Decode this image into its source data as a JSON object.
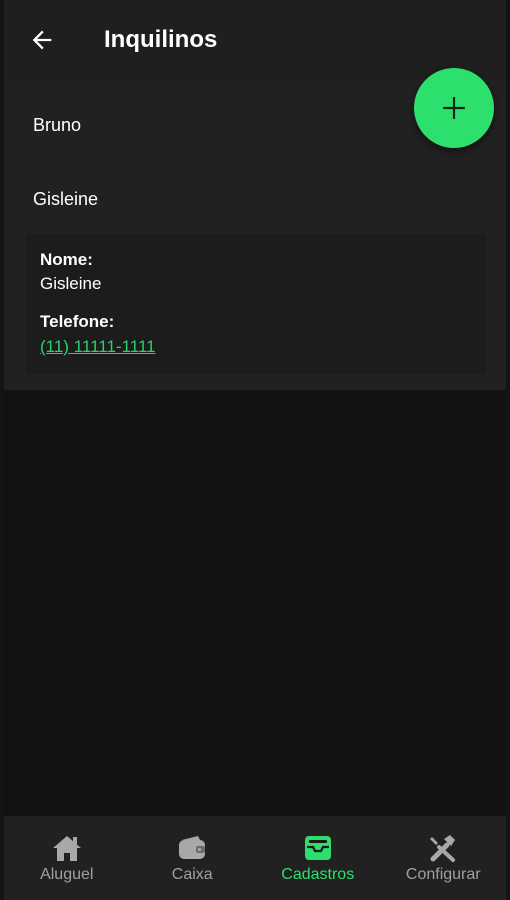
{
  "header": {
    "title": "Inquilinos",
    "back_icon": "arrow-left-icon"
  },
  "tenants": [
    {
      "name": "Bruno"
    },
    {
      "name": "Gisleine"
    }
  ],
  "detail": {
    "name_label": "Nome:",
    "name_value": "Gisleine",
    "phone_label": "Telefone:",
    "phone_value": "(11) 11111-1111"
  },
  "fab": {
    "icon": "plus-icon"
  },
  "bottom_nav": {
    "items": [
      {
        "label": "Aluguel",
        "icon": "home-icon"
      },
      {
        "label": "Caixa",
        "icon": "wallet-icon"
      },
      {
        "label": "Cadastros",
        "icon": "inbox-icon"
      },
      {
        "label": "Configurar",
        "icon": "tools-icon"
      }
    ],
    "active_index": 2
  },
  "colors": {
    "accent": "#2ddf6d",
    "link": "#2fd06a",
    "background": "#121212",
    "surface": "#212121",
    "header": "#1f1f1f",
    "nav_inactive": "#a0a0a0"
  }
}
